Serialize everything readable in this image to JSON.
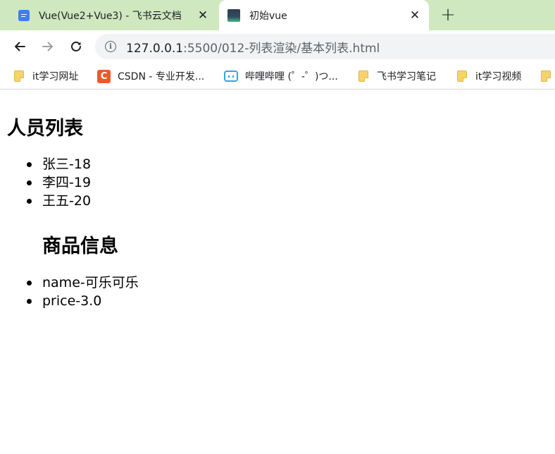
{
  "browser": {
    "tabs": [
      {
        "title": "Vue(Vue2+Vue3) - 飞书云文档",
        "close": "✕"
      },
      {
        "title": "初始vue",
        "close": "✕"
      }
    ],
    "new_tab": "+",
    "address": {
      "host": "127.0.0.1",
      "path": ":5500/012-列表渲染/基本列表.html"
    },
    "bookmarks": [
      {
        "label": "it学习网址",
        "icon": "folder-icon"
      },
      {
        "label": "CSDN - 专业开发...",
        "icon": "csdn-icon"
      },
      {
        "label": "哔哩哔哩 (゜-゜)つ...",
        "icon": "bilibili-icon"
      },
      {
        "label": "飞书学习笔记",
        "icon": "folder-icon"
      },
      {
        "label": "it学习视频",
        "icon": "folder-icon"
      }
    ],
    "csdn_glyph": "C"
  },
  "page": {
    "persons_heading": "人员列表",
    "persons": [
      "张三-18",
      "李四-19",
      "王五-20"
    ],
    "goods_heading": "商品信息",
    "goods": [
      "name-可乐可乐",
      "price-3.0"
    ]
  }
}
